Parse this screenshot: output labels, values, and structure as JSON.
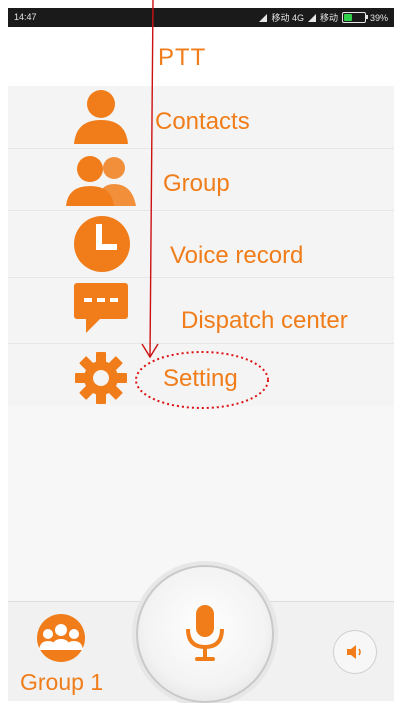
{
  "status_bar": {
    "time": "14:47",
    "carrier_1": "移动 4G",
    "carrier_2": "移动",
    "battery_percent": "39%",
    "battery_level": 0.39,
    "battery_color": "#2fd04a"
  },
  "app": {
    "title": "PTT",
    "accent_color": "#f07d1a"
  },
  "menu": {
    "items": [
      {
        "label": "Contacts",
        "icon": "person-icon"
      },
      {
        "label": "Group",
        "icon": "people-icon"
      },
      {
        "label": "Voice record",
        "icon": "clock-icon"
      },
      {
        "label": "Dispatch center",
        "icon": "chat-bubble-icon"
      },
      {
        "label": "Setting",
        "icon": "gear-icon"
      }
    ]
  },
  "bottom_bar": {
    "group_label": "Group 1",
    "group_icon": "group-avatar-icon",
    "ptt_icon": "microphone-icon",
    "speaker_icon": "speaker-icon"
  },
  "annotation": {
    "arrow_color": "#cc1111",
    "highlight_target": "Setting"
  }
}
